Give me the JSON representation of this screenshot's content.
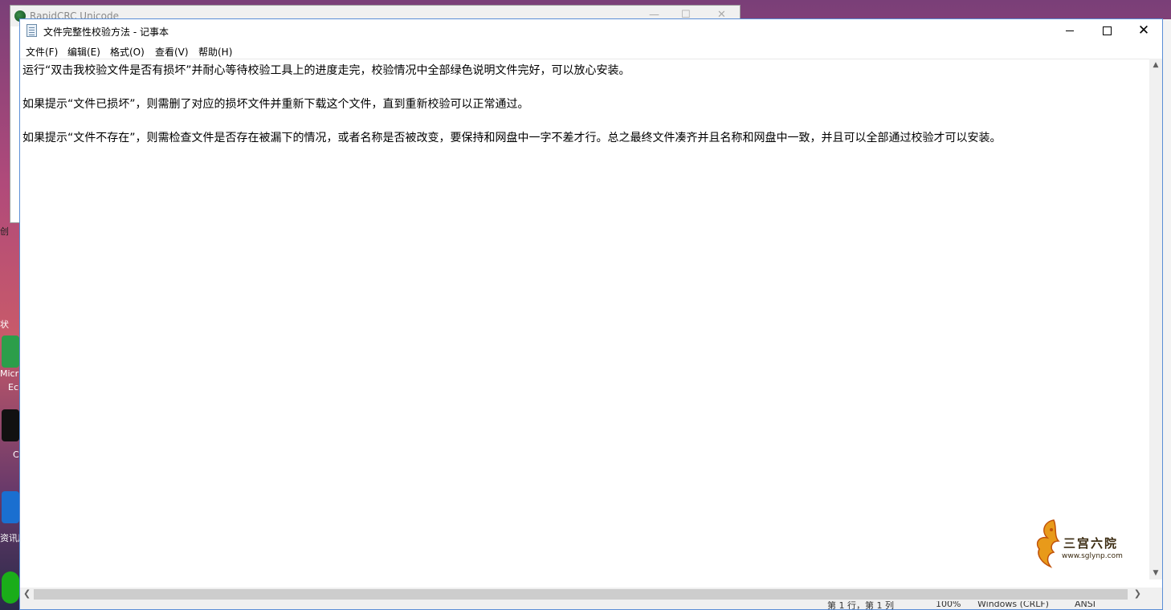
{
  "background_window": {
    "title": "RapidCRC Unicode"
  },
  "desktop": {
    "labels": [
      "创",
      "状",
      "Micr",
      "Ec",
      "C",
      "资讯用"
    ]
  },
  "window": {
    "title": "文件完整性校验方法 - 记事本",
    "minimize": "—",
    "maximize": "☐",
    "close": "✕"
  },
  "menu": {
    "items": [
      {
        "label": "文件(F)"
      },
      {
        "label": "编辑(E)"
      },
      {
        "label": "格式(O)"
      },
      {
        "label": "查看(V)"
      },
      {
        "label": "帮助(H)"
      }
    ]
  },
  "document": {
    "lines": [
      "运行“双击我校验文件是否有损坏”并耐心等待校验工具上的进度走完，校验情况中全部绿色说明文件完好，可以放心安装。",
      "如果提示“文件已损坏”，则需删了对应的损坏文件并重新下载这个文件，直到重新校验可以正常通过。",
      "如果提示“文件不存在”，则需检查文件是否存在被漏下的情况，或者名称是否被改变，要保持和网盘中一字不差才行。总之最终文件凑齐并且名称和网盘中一致，并且可以全部通过校验才可以安装。"
    ]
  },
  "status": {
    "position": "第 1 行，第 1 列",
    "zoom": "100%",
    "eol": "Windows (CRLF)",
    "encoding": "ANSI"
  },
  "watermark": {
    "text": "三宫六院",
    "url": "www.sglynp.com"
  }
}
